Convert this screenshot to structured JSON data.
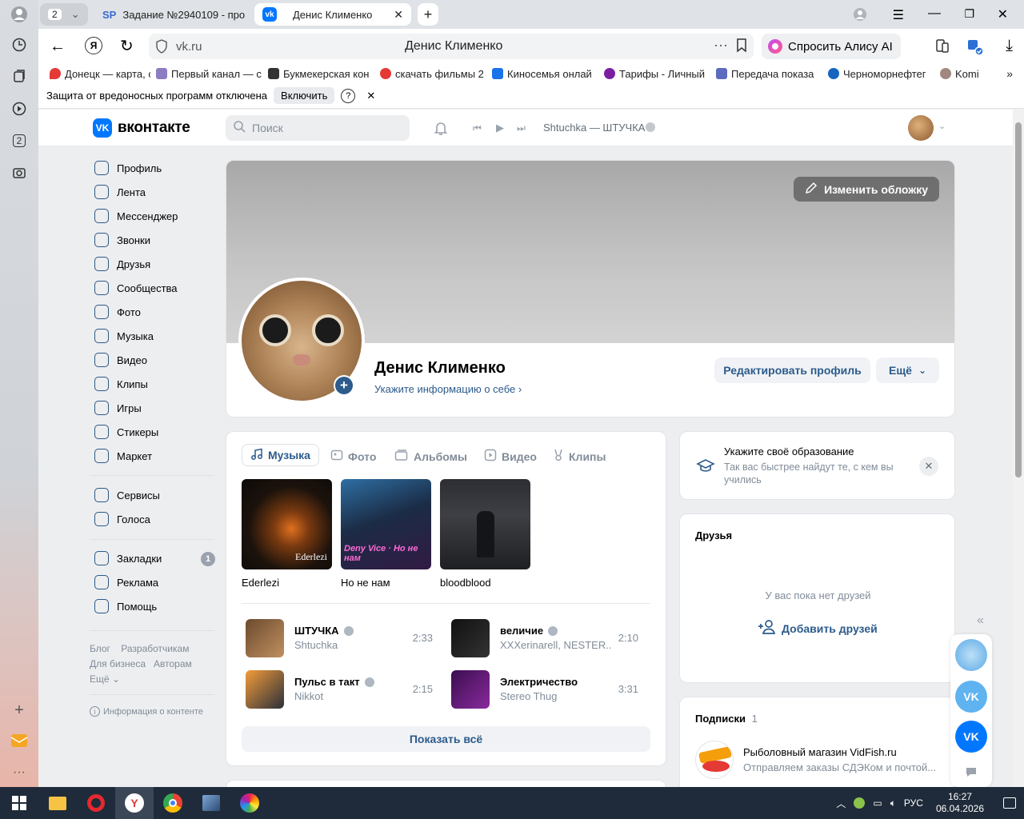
{
  "browser": {
    "tab_count": "2",
    "tabs": [
      {
        "label": "Задание №2940109 - про",
        "favicon": "SP"
      },
      {
        "label": "Денис Клименко"
      }
    ],
    "url": "vk.ru",
    "page_title": "Денис Клименко",
    "alice_button": "Спросить Алису AI",
    "bookmarks": [
      "Донецк — карта, с",
      "Первый канал — с",
      "Букмекерская кон",
      "скачать фильмы 2",
      "Киносемья онлай",
      "Тарифы - Личный",
      "Передача показа",
      "Черноморнефтег",
      "Komi"
    ],
    "infobar": {
      "text": "Защита от вредоносных программ отключена",
      "enable": "Включить",
      "help": "?",
      "close": "✕"
    },
    "sidebar_badge": "2"
  },
  "vk": {
    "logo": "вконтакте",
    "search_placeholder": "Поиск",
    "player_track": "Shtuchka — ШТУЧКА",
    "nav_main": [
      "Профиль",
      "Лента",
      "Мессенджер",
      "Звонки",
      "Друзья",
      "Сообщества",
      "Фото",
      "Музыка",
      "Видео",
      "Клипы",
      "Игры",
      "Стикеры",
      "Маркет"
    ],
    "nav_secondary": [
      "Сервисы",
      "Голоса"
    ],
    "nav_tertiary": [
      "Закладки",
      "Реклама",
      "Помощь"
    ],
    "bookmarks_badge": "1",
    "footer_links": [
      "Блог",
      "Разработчикам",
      "Для бизнеса",
      "Авторам",
      "Ещё"
    ],
    "content_info": "Информация о контенте",
    "cover_button": "Изменить обложку",
    "profile": {
      "name": "Денис Клименко",
      "subtitle": "Укажите информацию о себе",
      "edit_button": "Редактировать профиль",
      "more_button": "Ещё"
    },
    "media_tabs": [
      "Музыка",
      "Фото",
      "Альбомы",
      "Видео",
      "Клипы"
    ],
    "albums": [
      {
        "title": "Ederlezi",
        "cover_text": "Ederlezi"
      },
      {
        "title": "Но не нам",
        "cover_text": "Deny Vice · Но не нам"
      },
      {
        "title": "bloodblood",
        "cover_text": ""
      }
    ],
    "tracks": [
      {
        "title": "ШТУЧКА",
        "artist": "Shtuchka",
        "duration": "2:33",
        "verified": true
      },
      {
        "title": "величие",
        "artist": "XXXerinarell, NESTER...",
        "duration": "2:10",
        "verified": true
      },
      {
        "title": "Пульс в такт",
        "artist": "Nikkot",
        "duration": "2:15",
        "verified": true
      },
      {
        "title": "Электричество",
        "artist": "Stereo Thug",
        "duration": "3:31",
        "verified": false
      }
    ],
    "show_all": "Показать всё",
    "education": {
      "title": "Укажите своё образование",
      "text": "Так вас быстрее найдут те, с кем вы учились"
    },
    "friends": {
      "title": "Друзья",
      "empty": "У вас пока нет друзей",
      "add": "Добавить друзей"
    },
    "subscriptions": {
      "title": "Подписки",
      "count": "1",
      "item_title": "Рыболовный магазин VidFish.ru",
      "item_text": "Отправляем заказы СДЭКом и почтой..."
    }
  },
  "taskbar": {
    "lang": "РУС",
    "time": "16:27",
    "date": "06.04.2026"
  },
  "colors": {
    "accent": "#2c5b8c",
    "vk_blue": "#0077ff"
  }
}
